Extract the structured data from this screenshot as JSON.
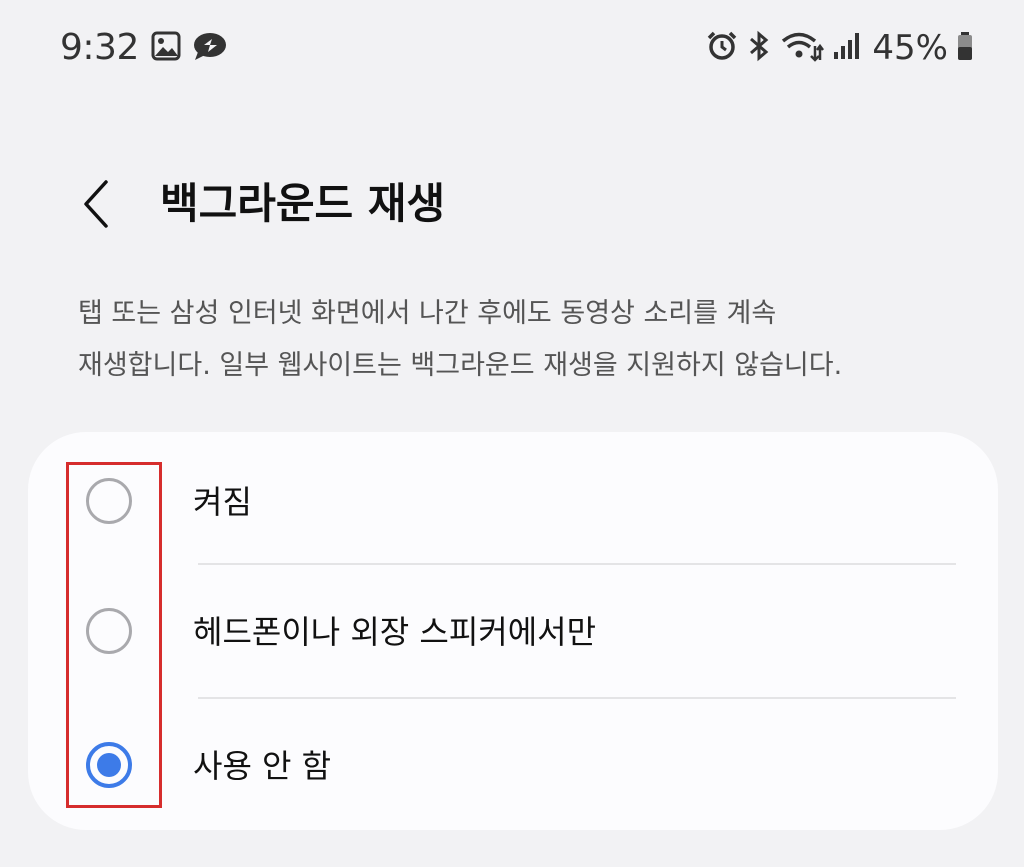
{
  "status_bar": {
    "time": "9:32",
    "left_icons": [
      "image-icon",
      "message-bubble-icon"
    ],
    "right_icons": [
      "alarm-icon",
      "bluetooth-icon",
      "wifi-icon",
      "signal-icon",
      "battery-icon"
    ],
    "battery": "45%"
  },
  "header": {
    "title": "백그라운드 재생"
  },
  "description": {
    "line1": "탭 또는 삼성 인터넷 화면에서 나간 후에도 동영상 소리를 계속",
    "line2": "재생합니다. 일부 웹사이트는 백그라운드 재생을 지원하지 않습니다."
  },
  "options": [
    {
      "label": "켜짐",
      "selected": false
    },
    {
      "label": "헤드폰이나 외장 스피커에서만",
      "selected": false
    },
    {
      "label": "사용 안 함",
      "selected": true
    }
  ],
  "colors": {
    "accent": "#3d7be8",
    "highlight": "#d62d2d",
    "background": "#f2f2f4",
    "card": "#fcfcfe"
  }
}
